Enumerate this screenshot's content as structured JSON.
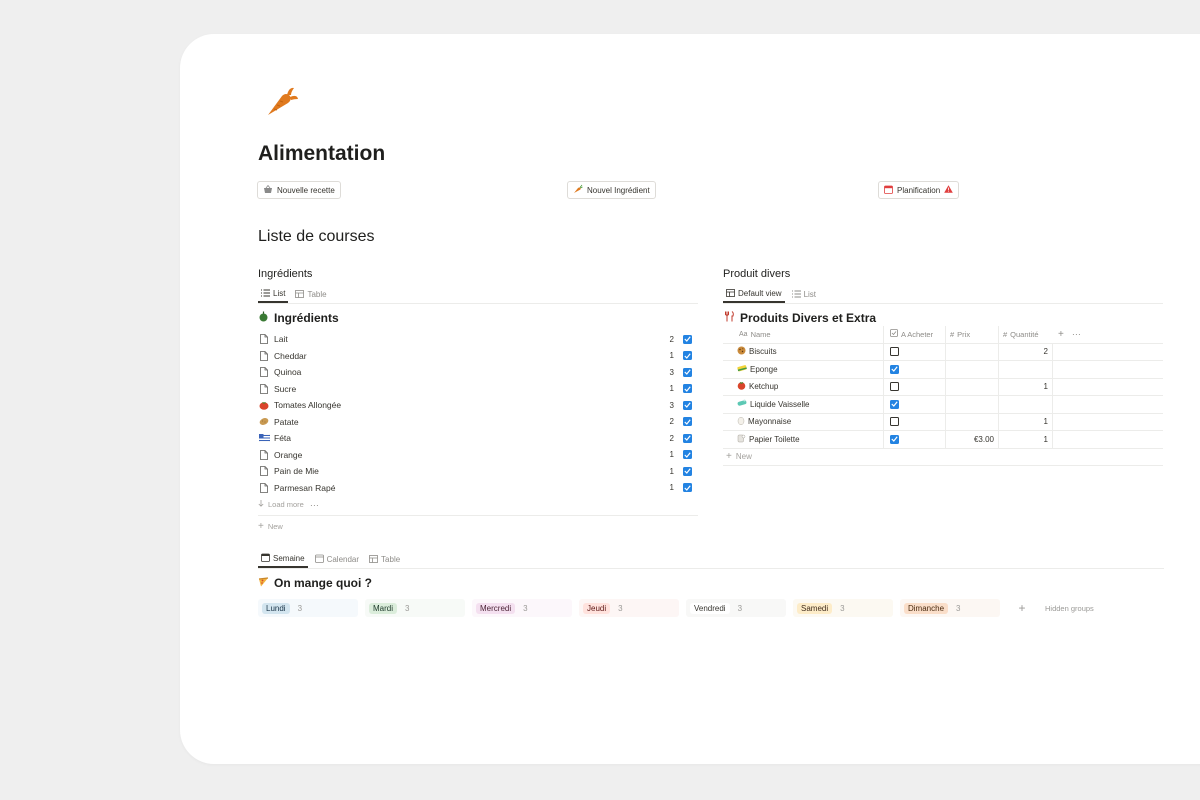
{
  "page": {
    "title": "Alimentation",
    "icon": "carrot-icon"
  },
  "buttons": [
    {
      "label": "Nouvelle recette",
      "icon": "basket-icon"
    },
    {
      "label": "Nouvel Ingrédient",
      "icon": "carrot-icon"
    },
    {
      "label": "Planification",
      "icon": "calendar-icon",
      "badge_icon": "warning-icon"
    }
  ],
  "shopping": {
    "title": "Liste de courses"
  },
  "ingredients": {
    "section_title": "Ingrédients",
    "tabs": [
      "List",
      "Table"
    ],
    "db_title": "Ingrédients",
    "items": [
      {
        "name": "Lait",
        "qty": "2",
        "checked": true,
        "icon": "page-icon"
      },
      {
        "name": "Cheddar",
        "qty": "1",
        "checked": true,
        "icon": "page-icon"
      },
      {
        "name": "Quinoa",
        "qty": "3",
        "checked": true,
        "icon": "page-icon"
      },
      {
        "name": "Sucre",
        "qty": "1",
        "checked": true,
        "icon": "page-icon"
      },
      {
        "name": "Tomates Allongée",
        "qty": "3",
        "checked": true,
        "icon": "tomato-icon"
      },
      {
        "name": "Patate",
        "qty": "2",
        "checked": true,
        "icon": "potato-icon"
      },
      {
        "name": "Féta",
        "qty": "2",
        "checked": true,
        "icon": "cheese-flag-icon"
      },
      {
        "name": "Orange",
        "qty": "1",
        "checked": true,
        "icon": "page-icon"
      },
      {
        "name": "Pain de Mie",
        "qty": "1",
        "checked": true,
        "icon": "page-icon"
      },
      {
        "name": "Parmesan Rapé",
        "qty": "1",
        "checked": true,
        "icon": "page-icon"
      }
    ],
    "load_more": "Load more",
    "new_label": "New"
  },
  "divers": {
    "section_title": "Produit divers",
    "tabs": [
      "Default view",
      "List"
    ],
    "db_title": "Produits Divers et Extra",
    "columns": {
      "name": "Name",
      "name_prefix": "Aa",
      "acheter": "A Acheter",
      "prix": "Prix",
      "quantite": "Quantité",
      "hash": "#"
    },
    "rows": [
      {
        "name": "Biscuits",
        "checked": false,
        "prix": "",
        "qty": "2",
        "icon": "cookie-icon"
      },
      {
        "name": "Eponge",
        "checked": true,
        "prix": "",
        "qty": "",
        "icon": "sponge-icon"
      },
      {
        "name": "Ketchup",
        "checked": false,
        "prix": "",
        "qty": "1",
        "icon": "tomato-icon"
      },
      {
        "name": "Liquide Vaisselle",
        "checked": true,
        "prix": "",
        "qty": "",
        "icon": "soap-icon"
      },
      {
        "name": "Mayonnaise",
        "checked": false,
        "prix": "",
        "qty": "1",
        "icon": "egg-icon"
      },
      {
        "name": "Papier Toilette",
        "checked": true,
        "prix": "€3.00",
        "qty": "1",
        "icon": "roll-icon"
      }
    ],
    "new_label": "New"
  },
  "planning": {
    "tabs": [
      "Semaine",
      "Calendar",
      "Table"
    ],
    "db_title": "On mange quoi ?",
    "groups": [
      {
        "name": "Lundi",
        "count": "3",
        "pill": "#d3e5ef",
        "bg": "#f5f9fc"
      },
      {
        "name": "Mardi",
        "count": "3",
        "pill": "#dbeddb",
        "bg": "#f7faf7"
      },
      {
        "name": "Mercredi",
        "count": "3",
        "pill": "#f4e0f0",
        "bg": "#fcf7fb"
      },
      {
        "name": "Jeudi",
        "count": "3",
        "pill": "#ffe2dd",
        "bg": "#fdf6f5"
      },
      {
        "name": "Vendredi",
        "count": "3",
        "pill": "#ffffff",
        "bg": "#f8f8f7"
      },
      {
        "name": "Samedi",
        "count": "3",
        "pill": "#fdecc8",
        "bg": "#fcf9f2"
      },
      {
        "name": "Dimanche",
        "count": "3",
        "pill": "#fadec9",
        "bg": "#fcf7f3"
      }
    ],
    "hidden_groups": "Hidden groups"
  }
}
